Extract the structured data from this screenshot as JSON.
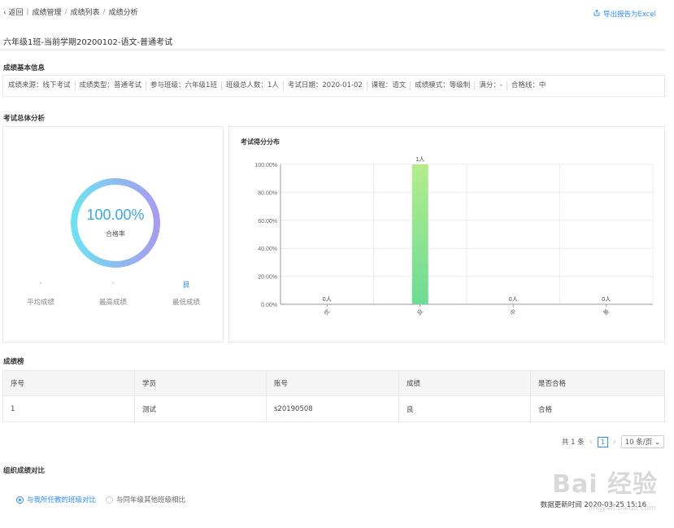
{
  "breadcrumb": {
    "back": "返回",
    "items": [
      "成绩管理",
      "成绩列表",
      "成绩分析"
    ]
  },
  "export_label": "导出报告为Excel",
  "page_title": "六年级1班-当前学期20200102-语文-普通考试",
  "basic_info": {
    "title": "成绩基本信息",
    "items": [
      "成绩来源：线下考试",
      "成绩类型：普通考试",
      "参与班级：六年级1班",
      "班级总人数：1人",
      "考试日期：2020-01-02",
      "课程：语文",
      "成绩模式：等级制",
      "满分：-",
      "合格线：中"
    ]
  },
  "overall": {
    "title": "考试总体分析",
    "pass_rate": "100.00%",
    "pass_rate_value": 1.0,
    "pass_rate_label": "合格率",
    "stats": [
      {
        "value": "-",
        "label": "平均成绩"
      },
      {
        "value": "-",
        "label": "最高成绩"
      },
      {
        "value": "良",
        "label": "最低成绩"
      }
    ]
  },
  "chart_data": {
    "type": "bar",
    "title": "考试得分分布",
    "categories": [
      "优",
      "良",
      "中",
      "差"
    ],
    "values": [
      0,
      100,
      0,
      0
    ],
    "value_labels": [
      "0人",
      "1人",
      "0人",
      "0人"
    ],
    "ylim": [
      0,
      100
    ],
    "yticks": [
      "0.00%",
      "20.00%",
      "40.00%",
      "60.00%",
      "80.00%",
      "100.00%"
    ],
    "grid": true,
    "colors": {
      "bar_top": "#b4ec8c",
      "bar_bottom": "#6cdc94"
    }
  },
  "ranking": {
    "title": "成绩榜",
    "columns": [
      "序号",
      "学员",
      "账号",
      "成绩",
      "是否合格"
    ],
    "rows": [
      [
        "1",
        "测试",
        "s20190508",
        "良",
        "合格"
      ]
    ]
  },
  "pager": {
    "total": "共 1 条",
    "current": "1",
    "page_size": "10 条/页"
  },
  "compare": {
    "title": "组织成绩对比",
    "options": [
      {
        "label": "与我所任教的班级对比",
        "selected": true
      },
      {
        "label": "与同年级其他班级相比",
        "selected": false
      }
    ],
    "update_time": "数据更新时间 2020-03-25 15:16"
  },
  "watermark": {
    "text": "Bai 经验",
    "sub": "jingyan.baidu.com"
  },
  "colors": {
    "accent": "#2d8cf0",
    "ring_start": "#6fe0f0",
    "ring_end": "#a69cf0"
  }
}
